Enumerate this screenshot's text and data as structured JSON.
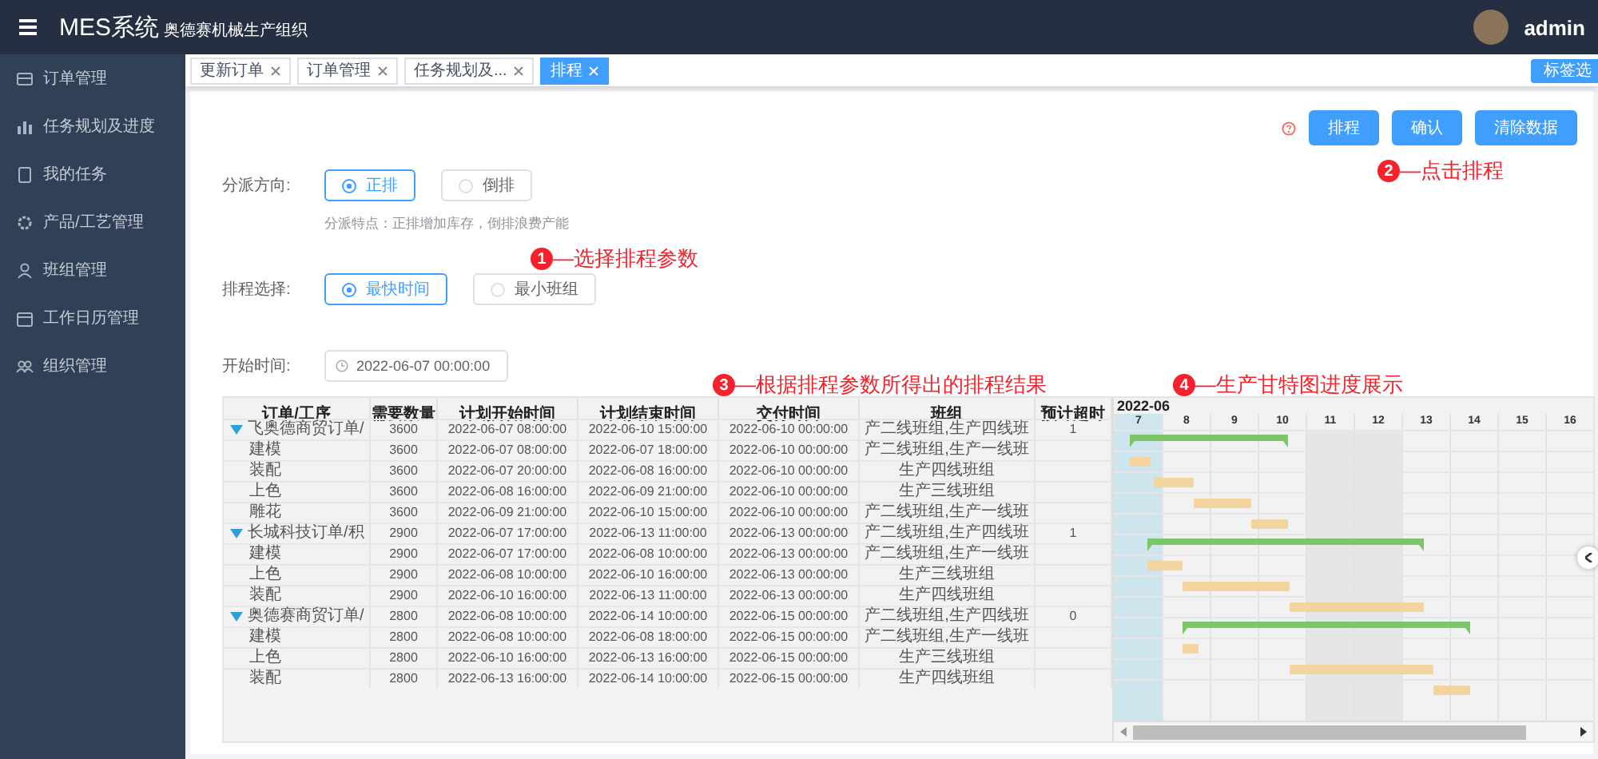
{
  "header": {
    "title": "MES系统",
    "subtitle": "奥德赛机械生产组织",
    "user": "admin"
  },
  "sidebar": {
    "items": [
      {
        "label": "订单管理"
      },
      {
        "label": "任务规划及进度"
      },
      {
        "label": "我的任务"
      },
      {
        "label": "产品/工艺管理"
      },
      {
        "label": "班组管理"
      },
      {
        "label": "工作日历管理"
      },
      {
        "label": "组织管理"
      }
    ]
  },
  "tabs": [
    {
      "label": "更新订单",
      "selected": false
    },
    {
      "label": "订单管理",
      "selected": false
    },
    {
      "label": "任务规划及...",
      "selected": false
    },
    {
      "label": "排程",
      "selected": true
    }
  ],
  "tab_options_button": "标签选",
  "toolbar": {
    "buttons": [
      "排程",
      "确认",
      "清除数据"
    ]
  },
  "annotations": [
    {
      "number": "1",
      "text": "—选择排程参数"
    },
    {
      "number": "2",
      "text": "—点击排程"
    },
    {
      "number": "3",
      "text": "—根据排程参数所得出的排程结果"
    },
    {
      "number": "4",
      "text": "—生产甘特图进度展示"
    }
  ],
  "form": {
    "direction": {
      "label": "分派方向:",
      "options": [
        {
          "label": "正排",
          "selected": true
        },
        {
          "label": "倒排",
          "selected": false
        }
      ],
      "hint": "分派特点：正排增加库存，倒排浪费产能"
    },
    "strategy": {
      "label": "排程选择:",
      "options": [
        {
          "label": "最快时间",
          "selected": true
        },
        {
          "label": "最小班组",
          "selected": false
        }
      ]
    },
    "start_time": {
      "label": "开始时间:",
      "value": "2022-06-07 00:00:00"
    }
  },
  "table": {
    "columns": [
      "订单/工序",
      "需要数量",
      "计划开始时间",
      "计划结束时间",
      "交付时间",
      "班组",
      "预计超时"
    ],
    "rows": [
      {
        "kind": "order",
        "expanded": true,
        "name": "飞奥德商贸订单/",
        "quantity": "3600",
        "start": "2022-06-07 08:00:00",
        "end": "2022-06-10 15:00:00",
        "delivery": "2022-06-10 00:00:00",
        "team": "产二线班组,生产四线班",
        "overtime": "1"
      },
      {
        "kind": "task",
        "name": "建模",
        "quantity": "3600",
        "start": "2022-06-07 08:00:00",
        "end": "2022-06-07 18:00:00",
        "delivery": "2022-06-10 00:00:00",
        "team": "产二线班组,生产一线班"
      },
      {
        "kind": "task",
        "name": "装配",
        "quantity": "3600",
        "start": "2022-06-07 20:00:00",
        "end": "2022-06-08 16:00:00",
        "delivery": "2022-06-10 00:00:00",
        "team": "生产四线班组"
      },
      {
        "kind": "task",
        "name": "上色",
        "quantity": "3600",
        "start": "2022-06-08 16:00:00",
        "end": "2022-06-09 21:00:00",
        "delivery": "2022-06-10 00:00:00",
        "team": "生产三线班组"
      },
      {
        "kind": "task",
        "name": "雕花",
        "quantity": "3600",
        "start": "2022-06-09 21:00:00",
        "end": "2022-06-10 15:00:00",
        "delivery": "2022-06-10 00:00:00",
        "team": "产二线班组,生产一线班"
      },
      {
        "kind": "order",
        "expanded": true,
        "name": "长城科技订单/积",
        "quantity": "2900",
        "start": "2022-06-07 17:00:00",
        "end": "2022-06-13 11:00:00",
        "delivery": "2022-06-13 00:00:00",
        "team": "产二线班组,生产四线班",
        "overtime": "1"
      },
      {
        "kind": "task",
        "name": "建模",
        "quantity": "2900",
        "start": "2022-06-07 17:00:00",
        "end": "2022-06-08 10:00:00",
        "delivery": "2022-06-13 00:00:00",
        "team": "产二线班组,生产一线班"
      },
      {
        "kind": "task",
        "name": "上色",
        "quantity": "2900",
        "start": "2022-06-08 10:00:00",
        "end": "2022-06-10 16:00:00",
        "delivery": "2022-06-13 00:00:00",
        "team": "生产三线班组"
      },
      {
        "kind": "task",
        "name": "装配",
        "quantity": "2900",
        "start": "2022-06-10 16:00:00",
        "end": "2022-06-13 11:00:00",
        "delivery": "2022-06-13 00:00:00",
        "team": "生产四线班组"
      },
      {
        "kind": "order",
        "expanded": true,
        "name": "奥德赛商贸订单/",
        "quantity": "2800",
        "start": "2022-06-08 10:00:00",
        "end": "2022-06-14 10:00:00",
        "delivery": "2022-06-15 00:00:00",
        "team": "产二线班组,生产四线班",
        "overtime": "0"
      },
      {
        "kind": "task",
        "name": "建模",
        "quantity": "2800",
        "start": "2022-06-08 10:00:00",
        "end": "2022-06-08 18:00:00",
        "delivery": "2022-06-15 00:00:00",
        "team": "产二线班组,生产一线班"
      },
      {
        "kind": "task",
        "name": "上色",
        "quantity": "2800",
        "start": "2022-06-10 16:00:00",
        "end": "2022-06-13 16:00:00",
        "delivery": "2022-06-15 00:00:00",
        "team": "生产三线班组"
      },
      {
        "kind": "task",
        "name": "装配",
        "quantity": "2800",
        "start": "2022-06-13 16:00:00",
        "end": "2022-06-14 10:00:00",
        "delivery": "2022-06-15 00:00:00",
        "team": "生产四线班组"
      }
    ]
  },
  "gantt": {
    "month": "2022-06",
    "days": [
      {
        "label": "7",
        "kind": "today"
      },
      {
        "label": "8",
        "kind": "workday"
      },
      {
        "label": "9",
        "kind": "workday"
      },
      {
        "label": "10",
        "kind": "workday"
      },
      {
        "label": "11",
        "kind": "weekend"
      },
      {
        "label": "12",
        "kind": "weekend"
      },
      {
        "label": "13",
        "kind": "workday"
      },
      {
        "label": "14",
        "kind": "workday"
      },
      {
        "label": "15",
        "kind": "workday"
      },
      {
        "label": "16",
        "kind": "workday"
      }
    ]
  }
}
